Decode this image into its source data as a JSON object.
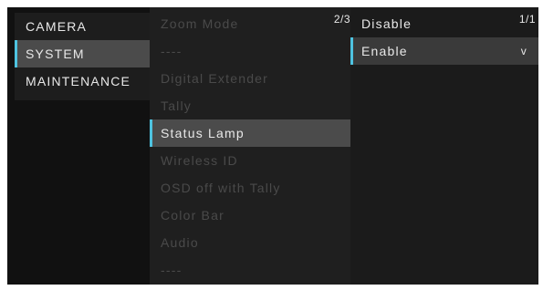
{
  "categories": [
    {
      "label": "CAMERA",
      "selected": false
    },
    {
      "label": "SYSTEM",
      "selected": true
    },
    {
      "label": "MAINTENANCE",
      "selected": false
    }
  ],
  "menu": {
    "page": "2/3",
    "items": [
      {
        "label": "Zoom Mode",
        "state": "dim"
      },
      {
        "label": "----",
        "state": "dim"
      },
      {
        "label": "Digital Extender",
        "state": "dim"
      },
      {
        "label": "Tally",
        "state": "dim"
      },
      {
        "label": "Status Lamp",
        "state": "selected"
      },
      {
        "label": "Wireless ID",
        "state": "dim"
      },
      {
        "label": "OSD off with Tally",
        "state": "dim"
      },
      {
        "label": "Color Bar",
        "state": "dim"
      },
      {
        "label": "Audio",
        "state": "dim"
      },
      {
        "label": "----",
        "state": "dim"
      }
    ]
  },
  "values": {
    "page": "1/1",
    "items": [
      {
        "label": "Disable",
        "selected": false,
        "mark": ""
      },
      {
        "label": "Enable",
        "selected": true,
        "mark": "v"
      }
    ]
  },
  "colors": {
    "accent": "#4ec3e0",
    "selected_bg": "#4b4b4b",
    "dim_text": "#4a4a4a",
    "text": "#e8e8e8"
  }
}
